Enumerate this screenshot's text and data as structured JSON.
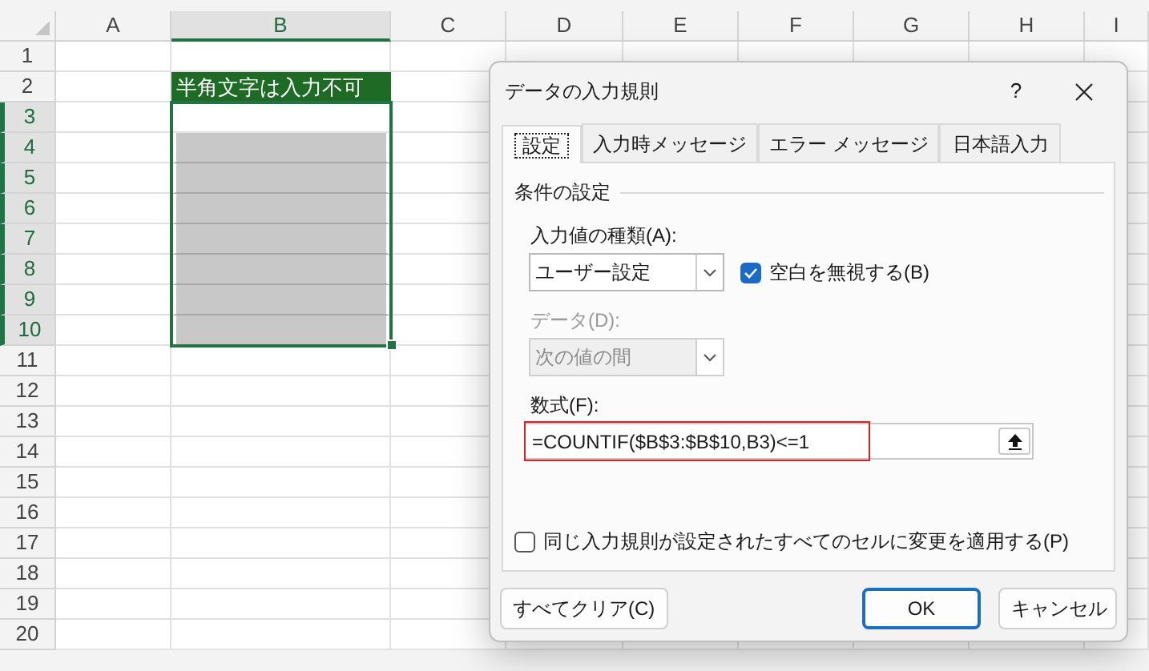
{
  "spreadsheet": {
    "columns": [
      {
        "label": "A",
        "selected": false
      },
      {
        "label": "B",
        "selected": true
      },
      {
        "label": "C",
        "selected": false
      },
      {
        "label": "D",
        "selected": false
      },
      {
        "label": "E",
        "selected": false
      },
      {
        "label": "F",
        "selected": false
      },
      {
        "label": "G",
        "selected": false
      },
      {
        "label": "H",
        "selected": false
      },
      {
        "label": "I",
        "selected": false
      }
    ],
    "rows": [
      {
        "label": "1",
        "selected": false,
        "cell_b": {
          "kind": "empty"
        }
      },
      {
        "label": "2",
        "selected": false,
        "cell_b": {
          "kind": "title",
          "text": "半角文字は入力不可"
        }
      },
      {
        "label": "3",
        "selected": true,
        "cell_b": {
          "kind": "empty"
        }
      },
      {
        "label": "4",
        "selected": true,
        "cell_b": {
          "kind": "shaded"
        }
      },
      {
        "label": "5",
        "selected": true,
        "cell_b": {
          "kind": "shaded"
        }
      },
      {
        "label": "6",
        "selected": true,
        "cell_b": {
          "kind": "shaded"
        }
      },
      {
        "label": "7",
        "selected": true,
        "cell_b": {
          "kind": "shaded"
        }
      },
      {
        "label": "8",
        "selected": true,
        "cell_b": {
          "kind": "shaded"
        }
      },
      {
        "label": "9",
        "selected": true,
        "cell_b": {
          "kind": "shaded"
        }
      },
      {
        "label": "10",
        "selected": true,
        "cell_b": {
          "kind": "shaded"
        }
      },
      {
        "label": "11",
        "selected": false,
        "cell_b": {
          "kind": "empty"
        }
      },
      {
        "label": "12",
        "selected": false,
        "cell_b": {
          "kind": "empty"
        }
      },
      {
        "label": "13",
        "selected": false,
        "cell_b": {
          "kind": "empty"
        }
      },
      {
        "label": "14",
        "selected": false,
        "cell_b": {
          "kind": "empty"
        }
      },
      {
        "label": "15",
        "selected": false,
        "cell_b": {
          "kind": "empty"
        }
      },
      {
        "label": "16",
        "selected": false,
        "cell_b": {
          "kind": "empty"
        }
      },
      {
        "label": "17",
        "selected": false,
        "cell_b": {
          "kind": "empty"
        }
      },
      {
        "label": "18",
        "selected": false,
        "cell_b": {
          "kind": "empty"
        }
      },
      {
        "label": "19",
        "selected": false,
        "cell_b": {
          "kind": "empty"
        }
      },
      {
        "label": "20",
        "selected": false,
        "cell_b": {
          "kind": "empty"
        }
      }
    ]
  },
  "dialog": {
    "title": "データの入力規則",
    "help": "?",
    "tabs": [
      {
        "label": "設定",
        "selected": true
      },
      {
        "label": "入力時メッセージ",
        "selected": false
      },
      {
        "label": "エラー メッセージ",
        "selected": false
      },
      {
        "label": "日本語入力",
        "selected": false
      }
    ],
    "group_title": "条件の設定",
    "allow": {
      "label": "入力値の種類(A):",
      "value": "ユーザー設定",
      "disabled": false
    },
    "ignore_blank": {
      "label": "空白を無視する(B)",
      "checked": true
    },
    "data": {
      "label": "データ(D):",
      "value": "次の値の間",
      "disabled": true
    },
    "formula": {
      "label": "数式(F):",
      "value": "=COUNTIF($B$3:$B$10,B3)<=1",
      "highlighted": true
    },
    "apply_all": {
      "label": "同じ入力規則が設定されたすべてのセルに変更を適用する(P)",
      "checked": false
    },
    "buttons": [
      {
        "label": "すべてクリア(C)",
        "kind": "normal"
      },
      {
        "label": "OK",
        "kind": "default"
      },
      {
        "label": "キャンセル",
        "kind": "normal"
      }
    ]
  }
}
